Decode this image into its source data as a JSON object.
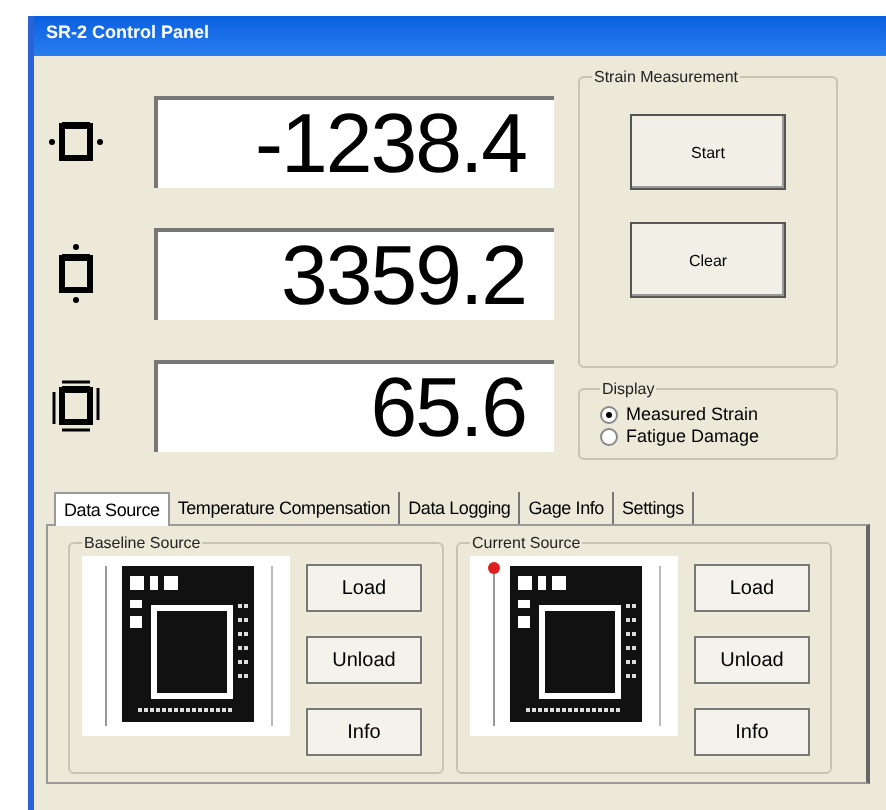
{
  "window": {
    "title": "SR-2 Control Panel"
  },
  "readouts": [
    {
      "kind": "horizontal",
      "value": "-1238.4"
    },
    {
      "kind": "vertical",
      "value": "3359.2"
    },
    {
      "kind": "shear",
      "value": "65.6"
    }
  ],
  "strain_measurement": {
    "title": "Strain Measurement",
    "buttons": [
      "Start",
      "Clear"
    ]
  },
  "display": {
    "title": "Display",
    "options": [
      {
        "label": "Measured Strain",
        "selected": true
      },
      {
        "label": "Fatigue Damage",
        "selected": false
      }
    ]
  },
  "tabs": [
    {
      "label": "Data Source",
      "selected": true
    },
    {
      "label": "Temperature Compensation",
      "selected": false
    },
    {
      "label": "Data Logging",
      "selected": false
    },
    {
      "label": "Gage Info",
      "selected": false
    },
    {
      "label": "Settings",
      "selected": false
    }
  ],
  "sources": [
    {
      "title": "Baseline Source",
      "marker": false,
      "buttons": [
        "Load",
        "Unload",
        "Info"
      ]
    },
    {
      "title": "Current Source",
      "marker": true,
      "buttons": [
        "Load",
        "Unload",
        "Info"
      ]
    }
  ]
}
